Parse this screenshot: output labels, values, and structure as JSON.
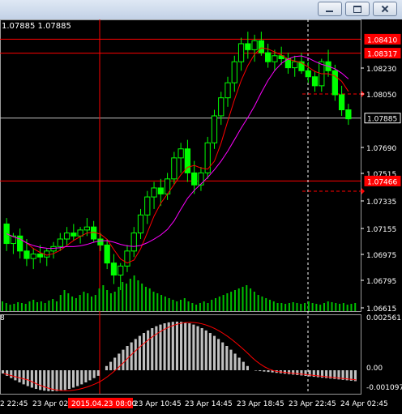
{
  "window": {
    "buttons": [
      "minimize",
      "maximize",
      "close"
    ]
  },
  "chart_header": {
    "ohlc": "1.07885 1.07885"
  },
  "price_axis": {
    "ticks": [
      "1.08230",
      "1.08050",
      "1.07690",
      "1.07515",
      "1.07335",
      "1.07155",
      "1.06975",
      "1.06795",
      "1.06615"
    ],
    "marked_levels": [
      {
        "label": "1.08410",
        "color": "#ff0000"
      },
      {
        "label": "1.08317",
        "color": "#ff0000"
      },
      {
        "label": "1.07885",
        "color": "#ffffff"
      },
      {
        "label": "1.07466",
        "color": "#ff0000"
      }
    ]
  },
  "subwindow": {
    "label": "8",
    "ticks": [
      "0.002561",
      "0.00",
      "-0.001097"
    ]
  },
  "time_axis": {
    "labels": [
      "2 22:45",
      "23 Apr 02:",
      "23 Apr 10:45",
      "23 Apr 14:45",
      "23 Apr 18:45",
      "23 Apr 22:45",
      "24 Apr 02:45"
    ],
    "crosshair_label": "2015.04.23 08:00"
  },
  "colors": {
    "bull_candle": "#00ff00",
    "bear_candle": "#00ff00",
    "ma_fast": "#ff0000",
    "ma_slow": "#ff00ff",
    "histogram": "#c0c0c0",
    "signal": "#ff0000",
    "level_line": "#ff0000",
    "current_price_line": "#c0c0c0"
  },
  "chart_data": {
    "type": "candlestick",
    "y_range": [
      1.066,
      1.0852
    ],
    "candles": [
      [
        1.0718,
        1.0722,
        1.07,
        1.0705
      ],
      [
        1.0705,
        1.0712,
        1.0698,
        1.071
      ],
      [
        1.071,
        1.0715,
        1.0695,
        1.07
      ],
      [
        1.07,
        1.0708,
        1.069,
        1.0695
      ],
      [
        1.0695,
        1.0702,
        1.0688,
        1.0698
      ],
      [
        1.0698,
        1.0704,
        1.0692,
        1.0696
      ],
      [
        1.0696,
        1.0702,
        1.069,
        1.07
      ],
      [
        1.07,
        1.0706,
        1.0695,
        1.0703
      ],
      [
        1.0703,
        1.0712,
        1.07,
        1.0708
      ],
      [
        1.0708,
        1.0716,
        1.0704,
        1.0712
      ],
      [
        1.0712,
        1.0718,
        1.0707,
        1.071
      ],
      [
        1.071,
        1.0716,
        1.0705,
        1.0714
      ],
      [
        1.0714,
        1.0722,
        1.071,
        1.0716
      ],
      [
        1.0716,
        1.072,
        1.0706,
        1.0708
      ],
      [
        1.0708,
        1.0712,
        1.07,
        1.0704
      ],
      [
        1.0704,
        1.0708,
        1.0688,
        1.0692
      ],
      [
        1.0692,
        1.0698,
        1.0678,
        1.0684
      ],
      [
        1.0684,
        1.0692,
        1.0674,
        1.069
      ],
      [
        1.069,
        1.0704,
        1.0686,
        1.07
      ],
      [
        1.07,
        1.0716,
        1.0696,
        1.0712
      ],
      [
        1.0712,
        1.0728,
        1.0708,
        1.0724
      ],
      [
        1.0724,
        1.074,
        1.0718,
        1.0736
      ],
      [
        1.0736,
        1.0746,
        1.0728,
        1.0742
      ],
      [
        1.0742,
        1.0748,
        1.073,
        1.0738
      ],
      [
        1.0738,
        1.0752,
        1.0734,
        1.0748
      ],
      [
        1.0748,
        1.0766,
        1.0744,
        1.0762
      ],
      [
        1.0762,
        1.0772,
        1.0752,
        1.0768
      ],
      [
        1.0768,
        1.0774,
        1.0746,
        1.0752
      ],
      [
        1.0752,
        1.076,
        1.0738,
        1.0744
      ],
      [
        1.0744,
        1.0756,
        1.074,
        1.0752
      ],
      [
        1.0752,
        1.0776,
        1.0748,
        1.0772
      ],
      [
        1.0772,
        1.0794,
        1.0768,
        1.079
      ],
      [
        1.079,
        1.0806,
        1.0784,
        1.0802
      ],
      [
        1.0802,
        1.0816,
        1.0796,
        1.0812
      ],
      [
        1.0812,
        1.083,
        1.0806,
        1.0826
      ],
      [
        1.0826,
        1.0842,
        1.082,
        1.0838
      ],
      [
        1.0838,
        1.0846,
        1.0828,
        1.0834
      ],
      [
        1.0834,
        1.0844,
        1.0826,
        1.084
      ],
      [
        1.084,
        1.0846,
        1.083,
        1.0832
      ],
      [
        1.0832,
        1.0838,
        1.0822,
        1.0826
      ],
      [
        1.0826,
        1.0834,
        1.082,
        1.083
      ],
      [
        1.083,
        1.0836,
        1.0824,
        1.0828
      ],
      [
        1.0828,
        1.0832,
        1.0818,
        1.0822
      ],
      [
        1.0822,
        1.083,
        1.0816,
        1.0826
      ],
      [
        1.0826,
        1.0832,
        1.0818,
        1.082
      ],
      [
        1.082,
        1.0826,
        1.0812,
        1.0816
      ],
      [
        1.0816,
        1.082,
        1.0806,
        1.081
      ],
      [
        1.081,
        1.0828,
        1.0806,
        1.0826
      ],
      [
        1.0826,
        1.0834,
        1.0816,
        1.082
      ],
      [
        1.082,
        1.0824,
        1.08,
        1.0804
      ],
      [
        1.0804,
        1.081,
        1.079,
        1.0794
      ],
      [
        1.0794,
        1.0798,
        1.0784,
        1.0788
      ]
    ]
  }
}
